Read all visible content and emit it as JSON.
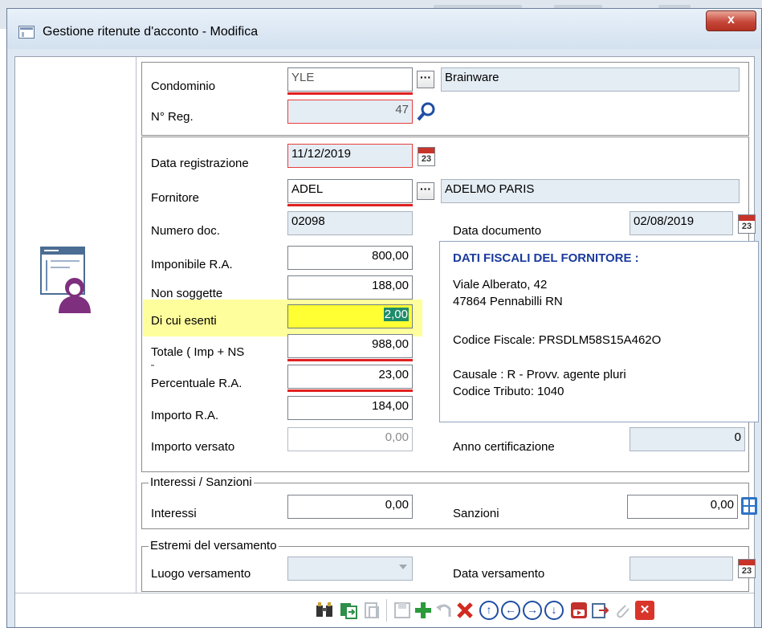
{
  "window": {
    "title": "Gestione ritenute d'acconto - Modifica",
    "close_label": "x"
  },
  "header": {
    "condominio_label": "Condominio",
    "condominio_code": "YLE",
    "condominio_name": "Brainware",
    "nreg_label": "N° Reg.",
    "nreg_value": "47"
  },
  "details": {
    "data_registrazione_label": "Data registrazione",
    "data_registrazione_value": "11/12/2019",
    "fornitore_label": "Fornitore",
    "fornitore_code": "ADEL",
    "fornitore_name": "ADELMO PARIS",
    "numero_doc_label": "Numero doc.",
    "numero_doc_value": "02098",
    "data_documento_label": "Data documento",
    "data_documento_value": "02/08/2019",
    "imponibile_label": "Imponibile R.A.",
    "imponibile_value": "800,00",
    "non_soggette_label": "Non soggette",
    "non_soggette_value": "188,00",
    "esenti_label": "Di cui esenti",
    "esenti_value": "2,00",
    "totale_label": "Totale ( Imp + NS",
    "totale_value": "988,00",
    "percentuale_label": "Percentuale R.A.",
    "percentuale_value": "23,00",
    "importo_label": "Importo R.A.",
    "importo_value": "184,00",
    "importo_versato_label": "Importo versato",
    "importo_versato_value": "0,00",
    "anno_cert_label": "Anno certificazione",
    "anno_cert_value": "0",
    "calendar_day": "23"
  },
  "fiscal_info": {
    "heading": "DATI FISCALI DEL FORNITORE :",
    "address1": "Viale Alberato, 42",
    "address2": "47864 Pennabilli RN",
    "codice_fiscale": "Codice Fiscale: PRSDLM58S15A462O",
    "causale": "Causale : R - Provv. agente pluri",
    "codice_tributo": "Codice Tributo: 1040"
  },
  "interessi": {
    "legend": "Interessi / Sanzioni",
    "interessi_label": "Interessi",
    "interessi_value": "0,00",
    "sanzioni_label": "Sanzioni",
    "sanzioni_value": "0,00"
  },
  "versamento": {
    "legend": "Estremi del versamento",
    "luogo_label": "Luogo versamento",
    "luogo_value": "",
    "data_label": "Data versamento",
    "data_value": ""
  },
  "colors": {
    "accent_blue": "#1f4ea3",
    "heading_blue": "#1a3a9c",
    "required_red": "#e02020",
    "highlight_yellow": "#fefe9c",
    "field_yellow": "#ffff33"
  }
}
